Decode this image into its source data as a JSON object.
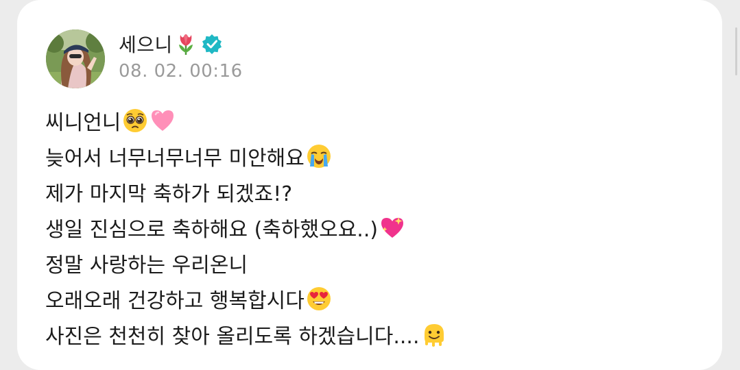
{
  "post": {
    "author_name": "세으니",
    "timestamp": "08. 02. 00:16",
    "lines": [
      {
        "text": "씨니언니",
        "emojis": [
          "pleading-face-emoji",
          "pink-heart-emoji"
        ]
      },
      {
        "text": "늦어서 너무너무너무 미안해요",
        "emojis": [
          "loudly-crying-face-emoji"
        ]
      },
      {
        "text": "제가 마지막 축하가 되겠죠!?",
        "emojis": []
      },
      {
        "text": "생일 진심으로 축하해요 (축하했오요..)",
        "emojis": [
          "sparkling-heart-emoji"
        ]
      },
      {
        "text": "정말 사랑하는 우리온니",
        "emojis": []
      },
      {
        "text": "오래오래 건강하고 행복합시다",
        "emojis": [
          "heart-eyes-emoji"
        ]
      },
      {
        "text": "사진은 천천히 찾아 올리도록 하겠습니다....",
        "emojis": [
          "melting-face-emoji"
        ]
      }
    ]
  },
  "icons": {
    "author_badge_emoji": "tulip-icon",
    "verified_badge": "verified-check-icon"
  },
  "colors": {
    "verified_badge": "#1fb8c4",
    "timestamp": "#9a9a9a",
    "text": "#1b1b1b",
    "card_background": "#ffffff",
    "page_background": "#ececec"
  }
}
